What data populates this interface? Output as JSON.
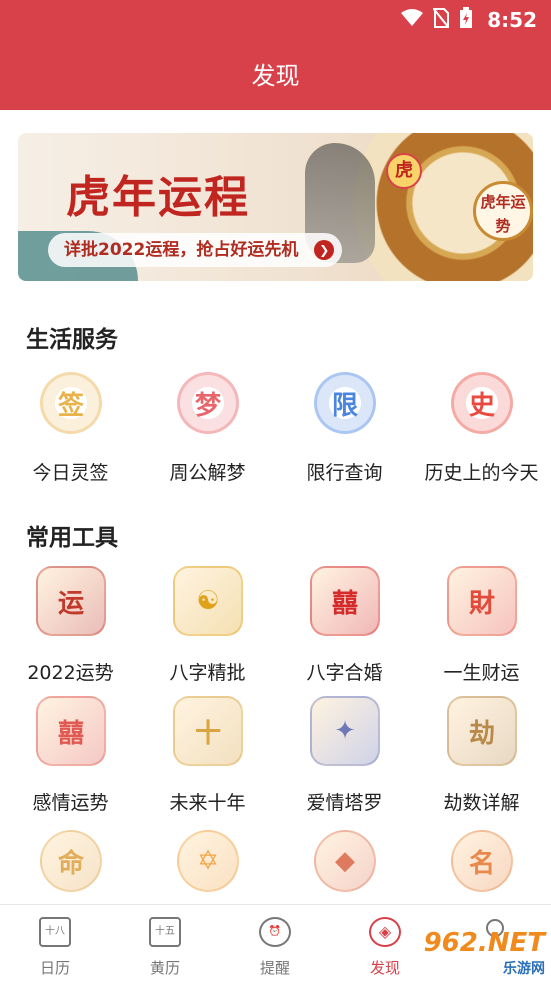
{
  "status_bar": {
    "time": "8:52",
    "icons": [
      "wifi-icon",
      "no-sim-icon",
      "battery-charging-icon"
    ]
  },
  "header": {
    "title": "发现"
  },
  "banner": {
    "headline": "虎年运程",
    "pill_text": "详批2022运程，抢占好运先机",
    "badge": "虎",
    "seal": "虎年运势"
  },
  "life_services": {
    "title": "生活服务",
    "items": [
      {
        "label": "今日灵签",
        "icon": "fortune-stick-icon",
        "glyph": "签",
        "color": "#e9b24b"
      },
      {
        "label": "周公解梦",
        "icon": "dream-icon",
        "glyph": "梦",
        "color": "#e8666b"
      },
      {
        "label": "限行查询",
        "icon": "traffic-limit-icon",
        "glyph": "限",
        "color": "#4a86e0"
      },
      {
        "label": "历史上的今天",
        "icon": "history-today-icon",
        "glyph": "史",
        "color": "#e9493f"
      }
    ]
  },
  "tools": {
    "title": "常用工具",
    "items": [
      {
        "label": "2022运势",
        "icon": "fortune-2022-icon",
        "glyph": "运",
        "color": "#c0392b"
      },
      {
        "label": "八字精批",
        "icon": "bazi-icon",
        "glyph": "☯",
        "color": "#e0a21a"
      },
      {
        "label": "八字合婚",
        "icon": "marriage-icon",
        "glyph": "囍",
        "color": "#d42a2a"
      },
      {
        "label": "一生财运",
        "icon": "wealth-bag-icon",
        "glyph": "財",
        "color": "#e24b3b"
      },
      {
        "label": "感情运势",
        "icon": "love-fortune-icon",
        "glyph": "囍",
        "color": "#e05a53"
      },
      {
        "label": "未来十年",
        "icon": "future-decade-icon",
        "glyph": "十",
        "color": "#d9a441"
      },
      {
        "label": "爱情塔罗",
        "icon": "tarot-icon",
        "glyph": "✦",
        "color": "#6f79b8"
      },
      {
        "label": "劫数详解",
        "icon": "scroll-book-icon",
        "glyph": "劫",
        "color": "#b88a4a"
      },
      {
        "label": "",
        "icon": "fate-book-icon",
        "glyph": "命",
        "color": "#e2ad5a"
      },
      {
        "label": "",
        "icon": "star-icon",
        "glyph": "✡",
        "color": "#f1a64b"
      },
      {
        "label": "",
        "icon": "crystal-icon",
        "glyph": "◆",
        "color": "#e07a5f"
      },
      {
        "label": "",
        "icon": "name-card-icon",
        "glyph": "名",
        "color": "#e8894b"
      }
    ]
  },
  "bottom_nav": [
    {
      "label": "日历",
      "icon": "calendar-icon",
      "glyph": "十八",
      "active": false
    },
    {
      "label": "黄历",
      "icon": "almanac-icon",
      "glyph": "十五",
      "active": false
    },
    {
      "label": "提醒",
      "icon": "alarm-clock-icon",
      "glyph": "⏰",
      "active": false
    },
    {
      "label": "发现",
      "icon": "compass-icon",
      "glyph": "◈",
      "active": true
    },
    {
      "label": "",
      "icon": "profile-icon",
      "glyph": "",
      "active": false
    }
  ],
  "watermark": {
    "brand": "962.NET",
    "sub": "乐游网"
  }
}
